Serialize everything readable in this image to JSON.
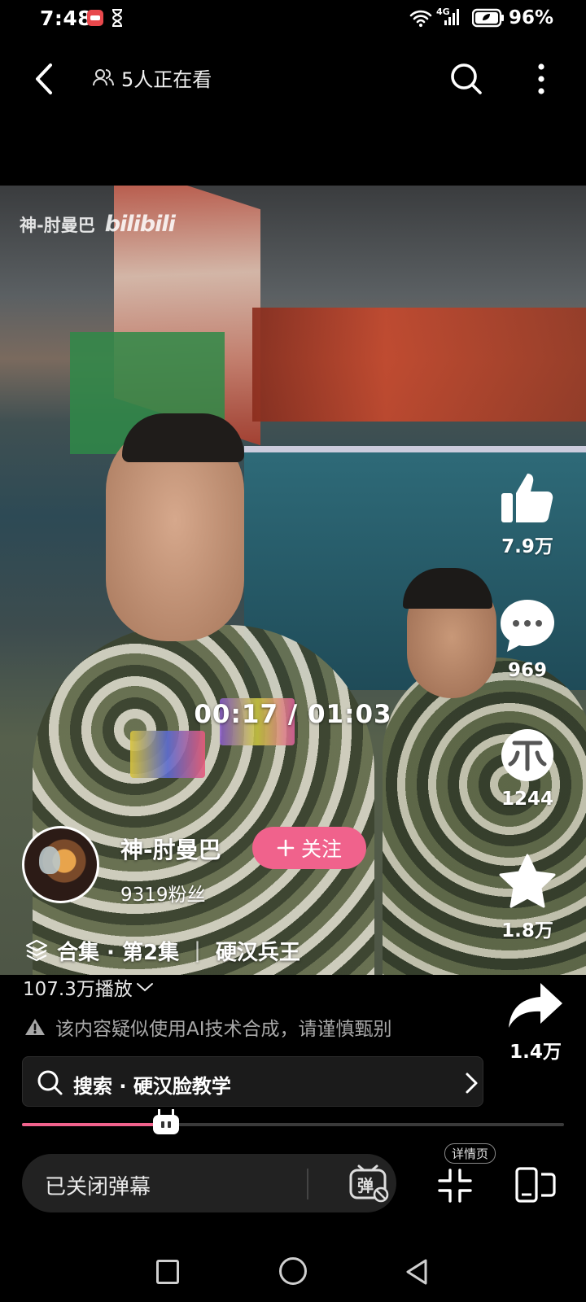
{
  "status_bar": {
    "time": "7:48",
    "network_badge": "4G",
    "battery": "96%"
  },
  "top_nav": {
    "watching": "5人正在看"
  },
  "video": {
    "watermark_name": "神-肘曼巴",
    "watermark_logo": "bilibili",
    "time_display": "00:17 / 01:03",
    "progress_fraction": 0.26
  },
  "actions": {
    "like_count": "7.9万",
    "comment_count": "969",
    "coin_count": "1244",
    "favorite_count": "1.8万",
    "share_count": "1.4万"
  },
  "uploader": {
    "name": "神-肘曼巴",
    "follow_label": "关注",
    "fans": "9319粉丝"
  },
  "collection": {
    "label": "合集 · 第2集",
    "title": "硬汉兵王"
  },
  "plays": "107.3万播放",
  "ai_notice": "该内容疑似使用AI技术合成，请谨慎甄别",
  "search": {
    "text": "搜索 · 硬汉脸教学"
  },
  "bottom_bar": {
    "danmaku_status": "已关闭弹幕",
    "danmaku_glyph": "弹",
    "detail_label": "详情页"
  },
  "colors": {
    "accent_pink": "#f0628c",
    "background": "#000000",
    "notice_gray": "#a8a8a8"
  },
  "icons": [
    "back-icon",
    "viewers-icon",
    "search-icon",
    "more-icon",
    "like-icon",
    "comment-icon",
    "coin-icon",
    "star-icon",
    "share-icon",
    "collection-icon",
    "warning-icon",
    "chevron-right-icon",
    "danmaku-off-icon",
    "shrink-icon",
    "portrait-icon"
  ]
}
